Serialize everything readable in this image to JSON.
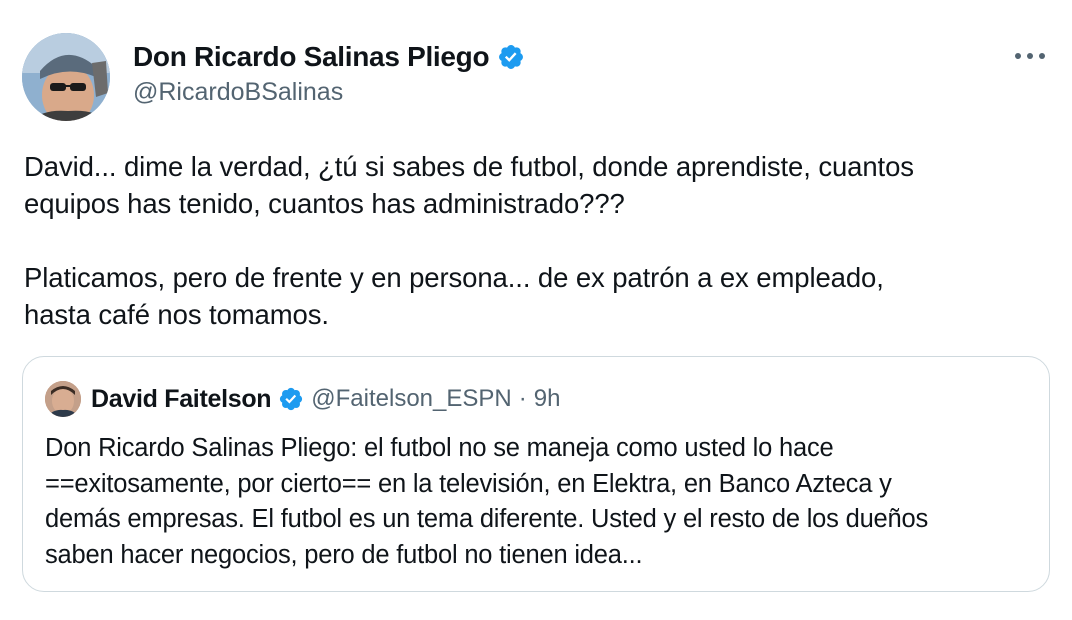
{
  "author": {
    "name": "Don Ricardo Salinas Pliego",
    "handle": "@RicardoBSalinas",
    "verified": true,
    "avatar_icon": "profile-photo-man-sunglasses-cap"
  },
  "tweet": {
    "text": "David... dime la verdad, ¿tú si sabes de futbol, donde aprendiste, cuantos\nequipos has tenido, cuantos has administrado???\n\nPlaticamos, pero de frente y en persona... de ex patrón a ex empleado,\nhasta café nos tomamos."
  },
  "more_icon": "more-horizontal-icon",
  "quote": {
    "name": "David Faitelson",
    "handle": "@Faitelson_ESPN",
    "separator": "·",
    "time": "9h",
    "verified": true,
    "avatar_icon": "profile-photo-man",
    "text": "Don Ricardo Salinas Pliego: el futbol no se maneja como usted lo hace\n==exitosamente, por cierto== en la televisión, en Elektra, en Banco Azteca y\ndemás empresas. El futbol es un tema diferente. Usted y el resto de los dueños\nsaben hacer negocios, pero de futbol no tienen idea..."
  },
  "colors": {
    "text": "#0f1419",
    "secondary": "#536471",
    "verified": "#1d9bf0",
    "border": "#cfd9de",
    "background": "#ffffff"
  }
}
